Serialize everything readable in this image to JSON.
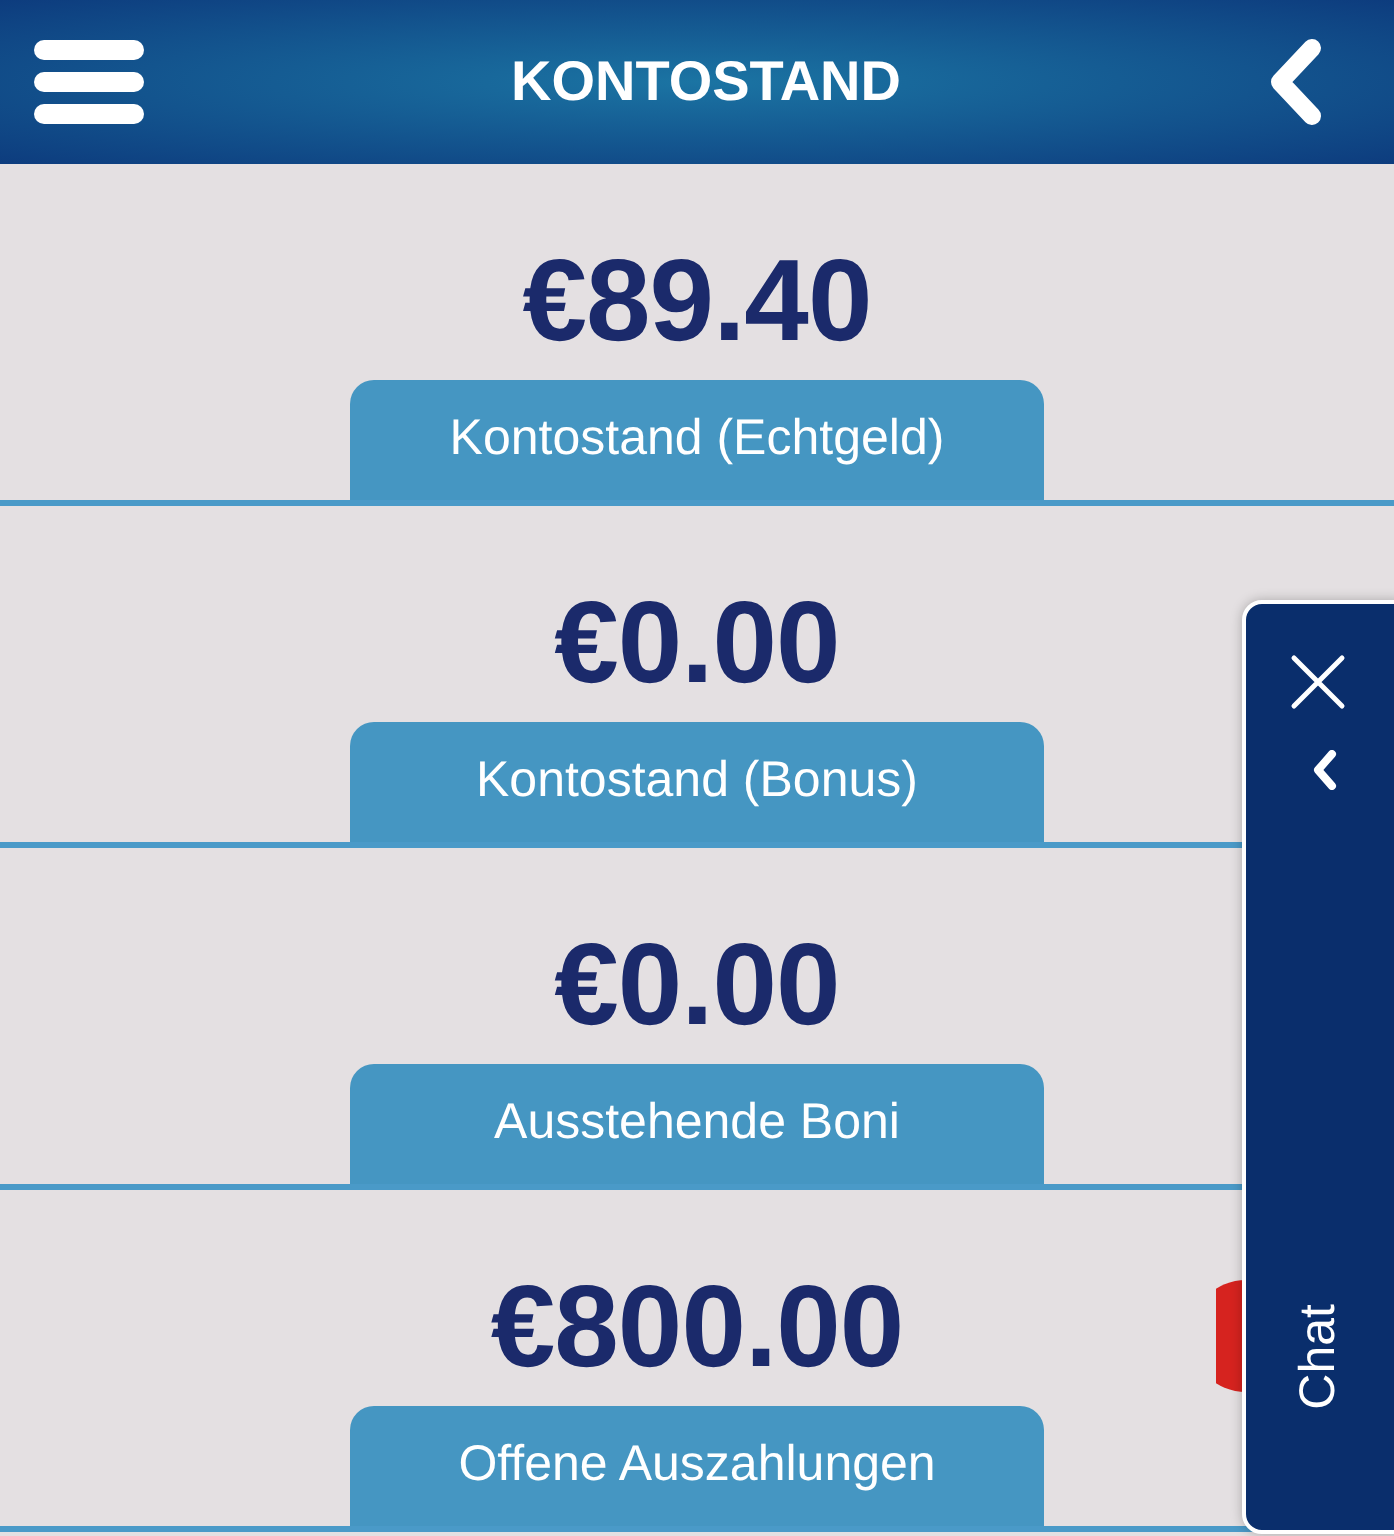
{
  "header": {
    "title": "KONTOSTAND"
  },
  "balances": [
    {
      "amount": "€89.40",
      "label": "Kontostand (Echtgeld)"
    },
    {
      "amount": "€0.00",
      "label": "Kontostand (Bonus)"
    },
    {
      "amount": "€0.00",
      "label": "Ausstehende Boni"
    },
    {
      "amount": "€800.00",
      "label": "Offene Auszahlungen"
    }
  ],
  "chat_panel": {
    "label": "Chat"
  }
}
